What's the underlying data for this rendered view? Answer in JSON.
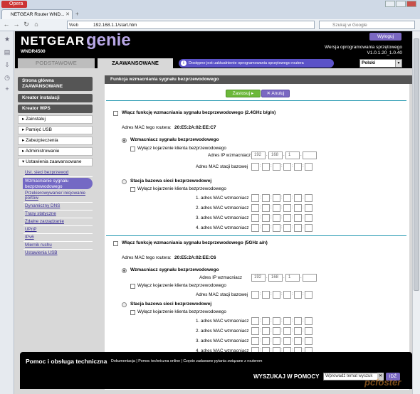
{
  "browser": {
    "app_button": "Opera",
    "tab_title": "NETGEAR Router WND...",
    "url_prefix": "Web",
    "url": "192.168.1.1/start.htm",
    "search_placeholder": "Szukaj w Google"
  },
  "header": {
    "brand": "NETGEAR",
    "product": "genie",
    "model": "WNDR4500",
    "logout_label": "Wyloguj",
    "firmware_label": "Wersja oprogramowania sprzętowego",
    "firmware_version": "V1.0.1.20_1.0.40"
  },
  "tabs": {
    "basic": "PODSTAWOWE",
    "advanced": "ZAAWANSOWANE",
    "update_notice": "Dostępne jest uaktualnienie oprogramowania sprzętowego routera",
    "language": "Polski"
  },
  "nav": {
    "home": "Strona główna ZAAWANSOWANE",
    "setup_wizard": "Kreator instalacji",
    "wps_wizard": "Kreator WPS",
    "sections": [
      "Zainstaluj",
      "Pamięć USB",
      "Zabezpieczenia",
      "Administrowanie",
      "Ustawienia zaawansowane"
    ],
    "sub_items": [
      "Ust. sieci bezprzewod",
      "Wzmacnianie sygnału bezprzewodowego",
      "Przekierowywanie/ inicjowanie portów",
      "Dynamiczny DNS",
      "Trasy statyczne",
      "Zdalne zarządzanie",
      "UPnP",
      "IPv6",
      "Miernik ruchu",
      "Ustawienia USB"
    ]
  },
  "content": {
    "title": "Funkcja wzmacniania sygnału bezprzewodowego",
    "apply_label": "Zastosuj ▸",
    "cancel_label": "✕ Anuluj",
    "band1": {
      "enable_label": "Włącz funkcję wzmacniania sygnału bezprzewodowego (2.4GHz b/g/n)",
      "mac_label": "Adres MAC tego routera:",
      "mac_value": "20:E5:2A:02:EE:C7",
      "repeater_label": "Wzmacniacz sygnału bezprzewodowego",
      "disable_assoc": "Wyłącz kojarzenie klienta bezprzewodowego",
      "ip_label": "Adres IP wzmacniacz",
      "ip": [
        "192",
        "168",
        "1",
        ""
      ],
      "base_mac_label": "Adres MAC stacji bazowej",
      "base_station_label": "Stacja bazowa sieci bezprzewodowej",
      "disable_assoc2": "Wyłącz kojarzenie klienta bezprzewodowego",
      "repeater_macs": [
        "1. adres MAC wzmacniacz",
        "2. adres MAC wzmacniacz",
        "3. adres MAC wzmacniacz",
        "4. adres MAC wzmacniacz"
      ]
    },
    "band2": {
      "enable_label": "Włącz funkcję wzmacniania sygnału bezprzewodowego (5GHz a/n)",
      "mac_label": "Adres MAC tego routera:",
      "mac_value": "20:E5:2A:02:EE:C6",
      "repeater_label": "Wzmacniacz sygnału bezprzewodowego",
      "disable_assoc": "Wyłącz kojarzenie klienta bezprzewodowego",
      "ip_label": "Adres IP wzmacniacz",
      "ip": [
        "192",
        "168",
        "1",
        ""
      ],
      "base_mac_label": "Adres MAC stacji bazowej",
      "base_station_label": "Stacja bazowa sieci bezprzewodowej",
      "disable_assoc2": "Wyłącz kojarzenie klienta bezprzewodowego",
      "repeater_macs": [
        "1. adres MAC wzmacniacz",
        "2. adres MAC wzmacniacz",
        "3. adres MAC wzmacniacz",
        "4. adres MAC wzmacniacz"
      ]
    }
  },
  "footer": {
    "title": "Pomoc i obsługa techniczna",
    "links": [
      "Dokumentacja",
      "Pomoc techniczna online",
      "Często zadawane pytania związane z routerem"
    ],
    "search_label": "WYSZUKAJ W POMOCY",
    "search_value": "Wprowadź temat wyszuk",
    "search_button": "IDŹ"
  },
  "watermark": "pcfoster"
}
